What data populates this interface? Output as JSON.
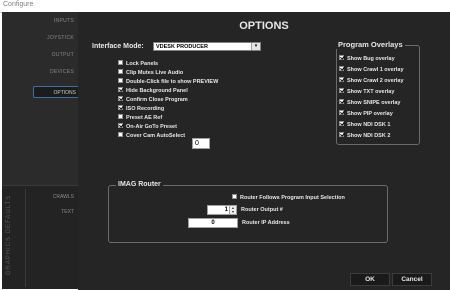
{
  "window": {
    "title": "Configure"
  },
  "sidebar": {
    "items": [
      {
        "label": "INPUTS"
      },
      {
        "label": "JOYSTICK"
      },
      {
        "label": "OUTPUT"
      },
      {
        "label": "DEVICES"
      },
      {
        "label": "OPTIONS"
      }
    ],
    "active": "OPTIONS",
    "lower_tabs": [
      {
        "label": "CRAWLS"
      },
      {
        "label": "TEXT"
      }
    ],
    "vertical_tab": "GRAPHICS DEFAULTS"
  },
  "main": {
    "title": "OPTIONS",
    "interface_mode": {
      "label": "Interface Mode:",
      "value": "VDESK PRODUCER"
    },
    "options": [
      {
        "label": "Lock Panels",
        "checked": false
      },
      {
        "label": "Clip Mutes Live Audio",
        "checked": false
      },
      {
        "label": "Double-Click file to show PREVIEW",
        "checked": false
      },
      {
        "label": "Hide Background Panel",
        "checked": true
      },
      {
        "label": "Confirm Close Program",
        "checked": true
      },
      {
        "label": "ISO Recording",
        "checked": true
      },
      {
        "label": "Preset AE Ref",
        "checked": false
      },
      {
        "label": "On-Air GoTo Preset",
        "checked": true
      },
      {
        "label": "Cover Cam AutoSelect",
        "checked": false
      }
    ],
    "cover_cam_value": "0",
    "program_overlays": {
      "title": "Program Overlays",
      "items": [
        {
          "label": "Show Bug overlay",
          "checked": true
        },
        {
          "label": "Show Crawl 1 overlay",
          "checked": true
        },
        {
          "label": "Show Crawl 2 overlay",
          "checked": true
        },
        {
          "label": "Show TXT overlay",
          "checked": true
        },
        {
          "label": "Show SNIPE overlay",
          "checked": true
        },
        {
          "label": "Show PIP overlay",
          "checked": true
        },
        {
          "label": "Show NDI DSK 1",
          "checked": true
        },
        {
          "label": "Show NDI DSK 2",
          "checked": true
        }
      ]
    },
    "imag_router": {
      "title": "IMAG Router",
      "follow_label": "Router Follows Program Input Selection",
      "follow_checked": false,
      "output_label": "Router Output #",
      "output_value": "1",
      "ip_label": "Router IP Address",
      "ip_value": "0"
    },
    "buttons": {
      "ok": "OK",
      "cancel": "Cancel"
    }
  },
  "colors": {
    "background": "#252525",
    "sidebar": "#2b2b2b",
    "accent": "#3a6fa8"
  }
}
